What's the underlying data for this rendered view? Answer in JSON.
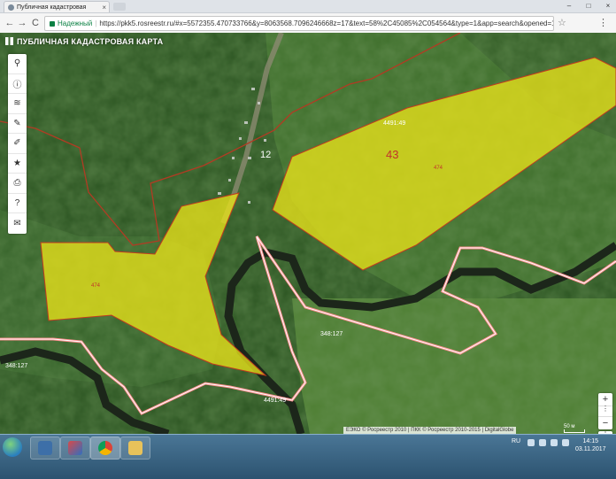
{
  "browser": {
    "tab_title": "Публичная кадастровая",
    "tab_close": "×",
    "window_buttons": [
      "–",
      "□",
      "×"
    ],
    "back": "←",
    "forward": "→",
    "reload": "C",
    "secure_label": "Надежный",
    "url": "https://pkk5.rosreestr.ru/#x=5572355.470733766&y=8063568.7096246668z=17&text=58%2C45085%2C054564&type=1&app=search&opened=1",
    "star": "☆",
    "menu": "⋮"
  },
  "map": {
    "app_title": "ПУБЛИЧНАЯ КАДАСТРОВАЯ КАРТА",
    "tools": [
      {
        "icon": "search-icon",
        "glyph": "⚲"
      },
      {
        "icon": "info-icon",
        "glyph": "ⓘ"
      },
      {
        "icon": "layers-icon",
        "glyph": "≋"
      },
      {
        "icon": "pencil-icon",
        "glyph": "✎"
      },
      {
        "icon": "measure-icon",
        "glyph": "✐"
      },
      {
        "icon": "favorites-icon",
        "glyph": "★"
      },
      {
        "icon": "print-icon",
        "glyph": "⎙"
      },
      {
        "icon": "help-icon",
        "glyph": "?"
      },
      {
        "icon": "mail-icon",
        "glyph": "✉"
      }
    ],
    "labels": {
      "plot_43": "43",
      "quarter_12": "12",
      "label_4491_49_top": "4491:49",
      "label_4491_49_bottom": "4491:49",
      "label_348_127_mid": "348:127",
      "label_348_127_left": "348:127",
      "label_474_right": "474",
      "label_474_left": "474"
    },
    "zoom_in": "+",
    "zoom_out": "−",
    "more": "⋮",
    "scale_label": "50 м",
    "attribution": "ЕЭКО © Росреестр 2010 | ПКК © Росреестр 2010-2015 | DigitalGlobe",
    "colors": {
      "plot_fill": "#e8e21a",
      "plot_border": "#c23a1f",
      "boundary": "#ff9a9a",
      "forest": "#2e5a24",
      "field": "#5f8c3c",
      "river": "#1f2a1c"
    }
  },
  "taskbar": {
    "lang": "RU",
    "time": "14:15",
    "date": "03.11.2017"
  }
}
